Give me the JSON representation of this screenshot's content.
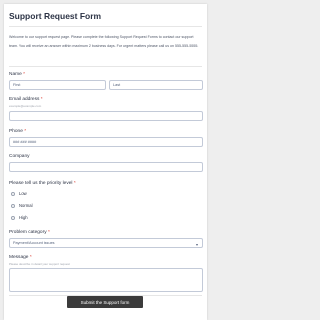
{
  "form": {
    "title": "Support Request Form",
    "intro": "Welcome to our support request page. Please complete the following Support Request Forms to contact our support team. You will receive an answer within maximum 2 business days. For urgent matters please call us on 555-555-5555.",
    "name": {
      "label": "Name",
      "first_placeholder": "First",
      "last_placeholder": "Last"
    },
    "email": {
      "label": "Email address",
      "sublabel": "example@example.com",
      "value": ""
    },
    "phone": {
      "label": "Phone",
      "placeholder": "### ### ####"
    },
    "company": {
      "label": "Company",
      "value": ""
    },
    "priority": {
      "label": "Please tell us the priority level",
      "options": [
        "Low",
        "Normal",
        "High"
      ]
    },
    "category": {
      "label": "Problem category",
      "selected": "Payment/Account issues"
    },
    "message": {
      "label": "Message",
      "sublabel": "Please describe in detail your support request"
    },
    "required_mark": "*",
    "submit_label": "Submit the Support form",
    "colors": {
      "accent": "#d9362b",
      "button": "#3b3b3b",
      "border": "#c3cad8"
    }
  }
}
